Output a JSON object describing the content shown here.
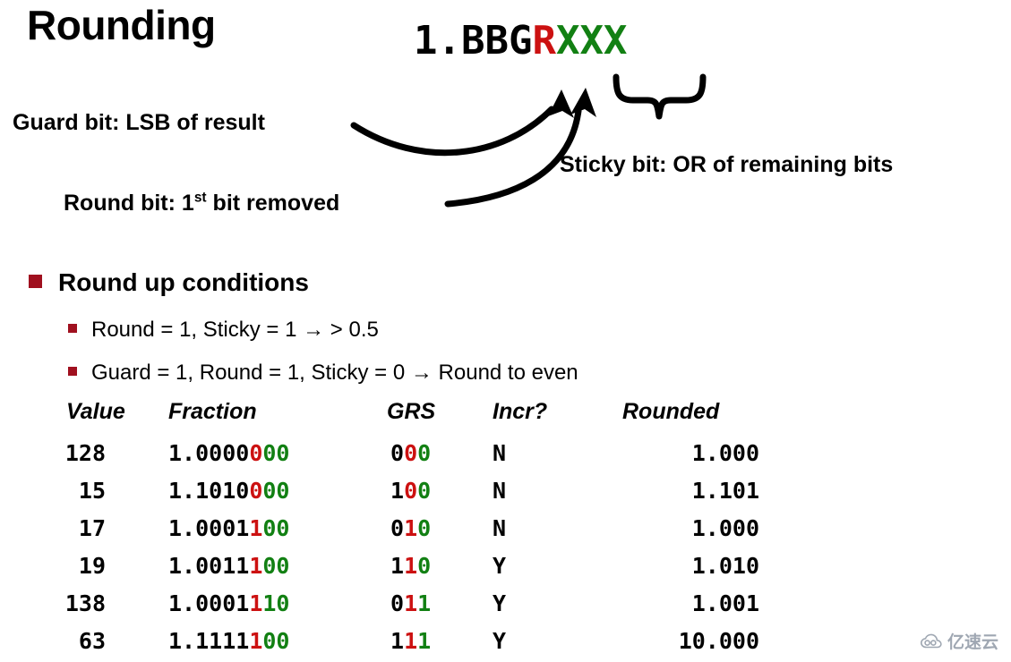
{
  "slide": {
    "title": "Rounding"
  },
  "bit_pattern": {
    "prefix": "1.BBG",
    "round_char": "R",
    "sticky_chars": "XXX",
    "colors": {
      "normal": "#000000",
      "round": "#CC1111",
      "sticky": "#128013"
    }
  },
  "callouts": {
    "guard": "Guard bit: LSB of result",
    "round_pre": "Round bit: 1",
    "round_sup": "st",
    "round_post": " bit removed",
    "sticky": "Sticky bit: OR of remaining bits"
  },
  "bullets": {
    "main": "Round up conditions",
    "sub": [
      "Round = 1, Sticky = 1 → > 0.5",
      "Guard = 1, Round = 1, Sticky = 0 → Round to even"
    ],
    "bullet_color": "#A0101F"
  },
  "table": {
    "headers": [
      "Value",
      "Fraction",
      "GRS",
      "Incr?",
      "Rounded"
    ],
    "rows": [
      {
        "value": "128",
        "fraction_black": "1.0000",
        "fraction_round": "0",
        "fraction_sticky": "00",
        "grs_guard": "0",
        "grs_round": "0",
        "grs_sticky": "0",
        "incr": "N",
        "rounded": "1.000"
      },
      {
        "value": "15",
        "fraction_black": "1.1010",
        "fraction_round": "0",
        "fraction_sticky": "00",
        "grs_guard": "1",
        "grs_round": "0",
        "grs_sticky": "0",
        "incr": "N",
        "rounded": "1.101"
      },
      {
        "value": "17",
        "fraction_black": "1.0001",
        "fraction_round": "1",
        "fraction_sticky": "00",
        "grs_guard": "0",
        "grs_round": "1",
        "grs_sticky": "0",
        "incr": "N",
        "rounded": "1.000"
      },
      {
        "value": "19",
        "fraction_black": "1.0011",
        "fraction_round": "1",
        "fraction_sticky": "00",
        "grs_guard": "1",
        "grs_round": "1",
        "grs_sticky": "0",
        "incr": "Y",
        "rounded": "1.010"
      },
      {
        "value": "138",
        "fraction_black": "1.0001",
        "fraction_round": "1",
        "fraction_sticky": "10",
        "grs_guard": "0",
        "grs_round": "1",
        "grs_sticky": "1",
        "incr": "Y",
        "rounded": "1.001"
      },
      {
        "value": "63",
        "fraction_black": "1.1111",
        "fraction_round": "1",
        "fraction_sticky": "00",
        "grs_guard": "1",
        "grs_round": "1",
        "grs_sticky": "1",
        "incr": "Y",
        "rounded": "10.000"
      }
    ]
  },
  "watermark": {
    "text": "亿速云"
  }
}
